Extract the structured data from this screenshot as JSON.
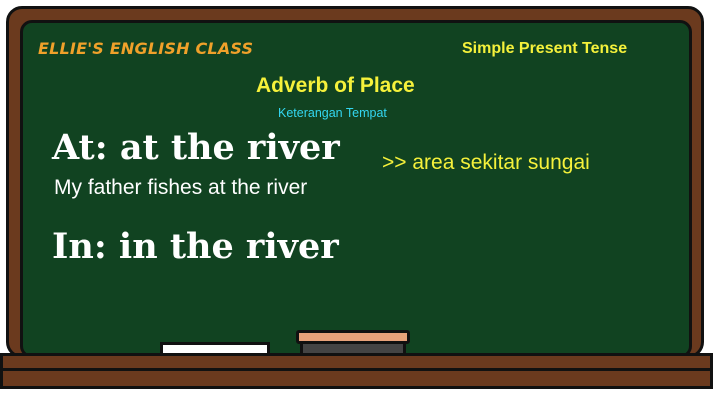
{
  "board": {
    "class_name": "ELLIE'S ENGLISH CLASS",
    "tense": "Simple Present Tense",
    "title": "Adverb of Place",
    "subtitle": "Keterangan Tempat",
    "sections": [
      {
        "heading": "At: at the river",
        "example": "My father fishes at the river",
        "meaning": ">> area sekitar sungai"
      },
      {
        "heading": "In: in the river"
      }
    ]
  },
  "colors": {
    "board_green": "#114321",
    "frame_brown": "#6b3a1e",
    "title_yellow": "#f5f13b",
    "class_orange": "#f0a12a",
    "subtitle_cyan": "#33d6f0",
    "chalk_white": "#ffffff"
  }
}
